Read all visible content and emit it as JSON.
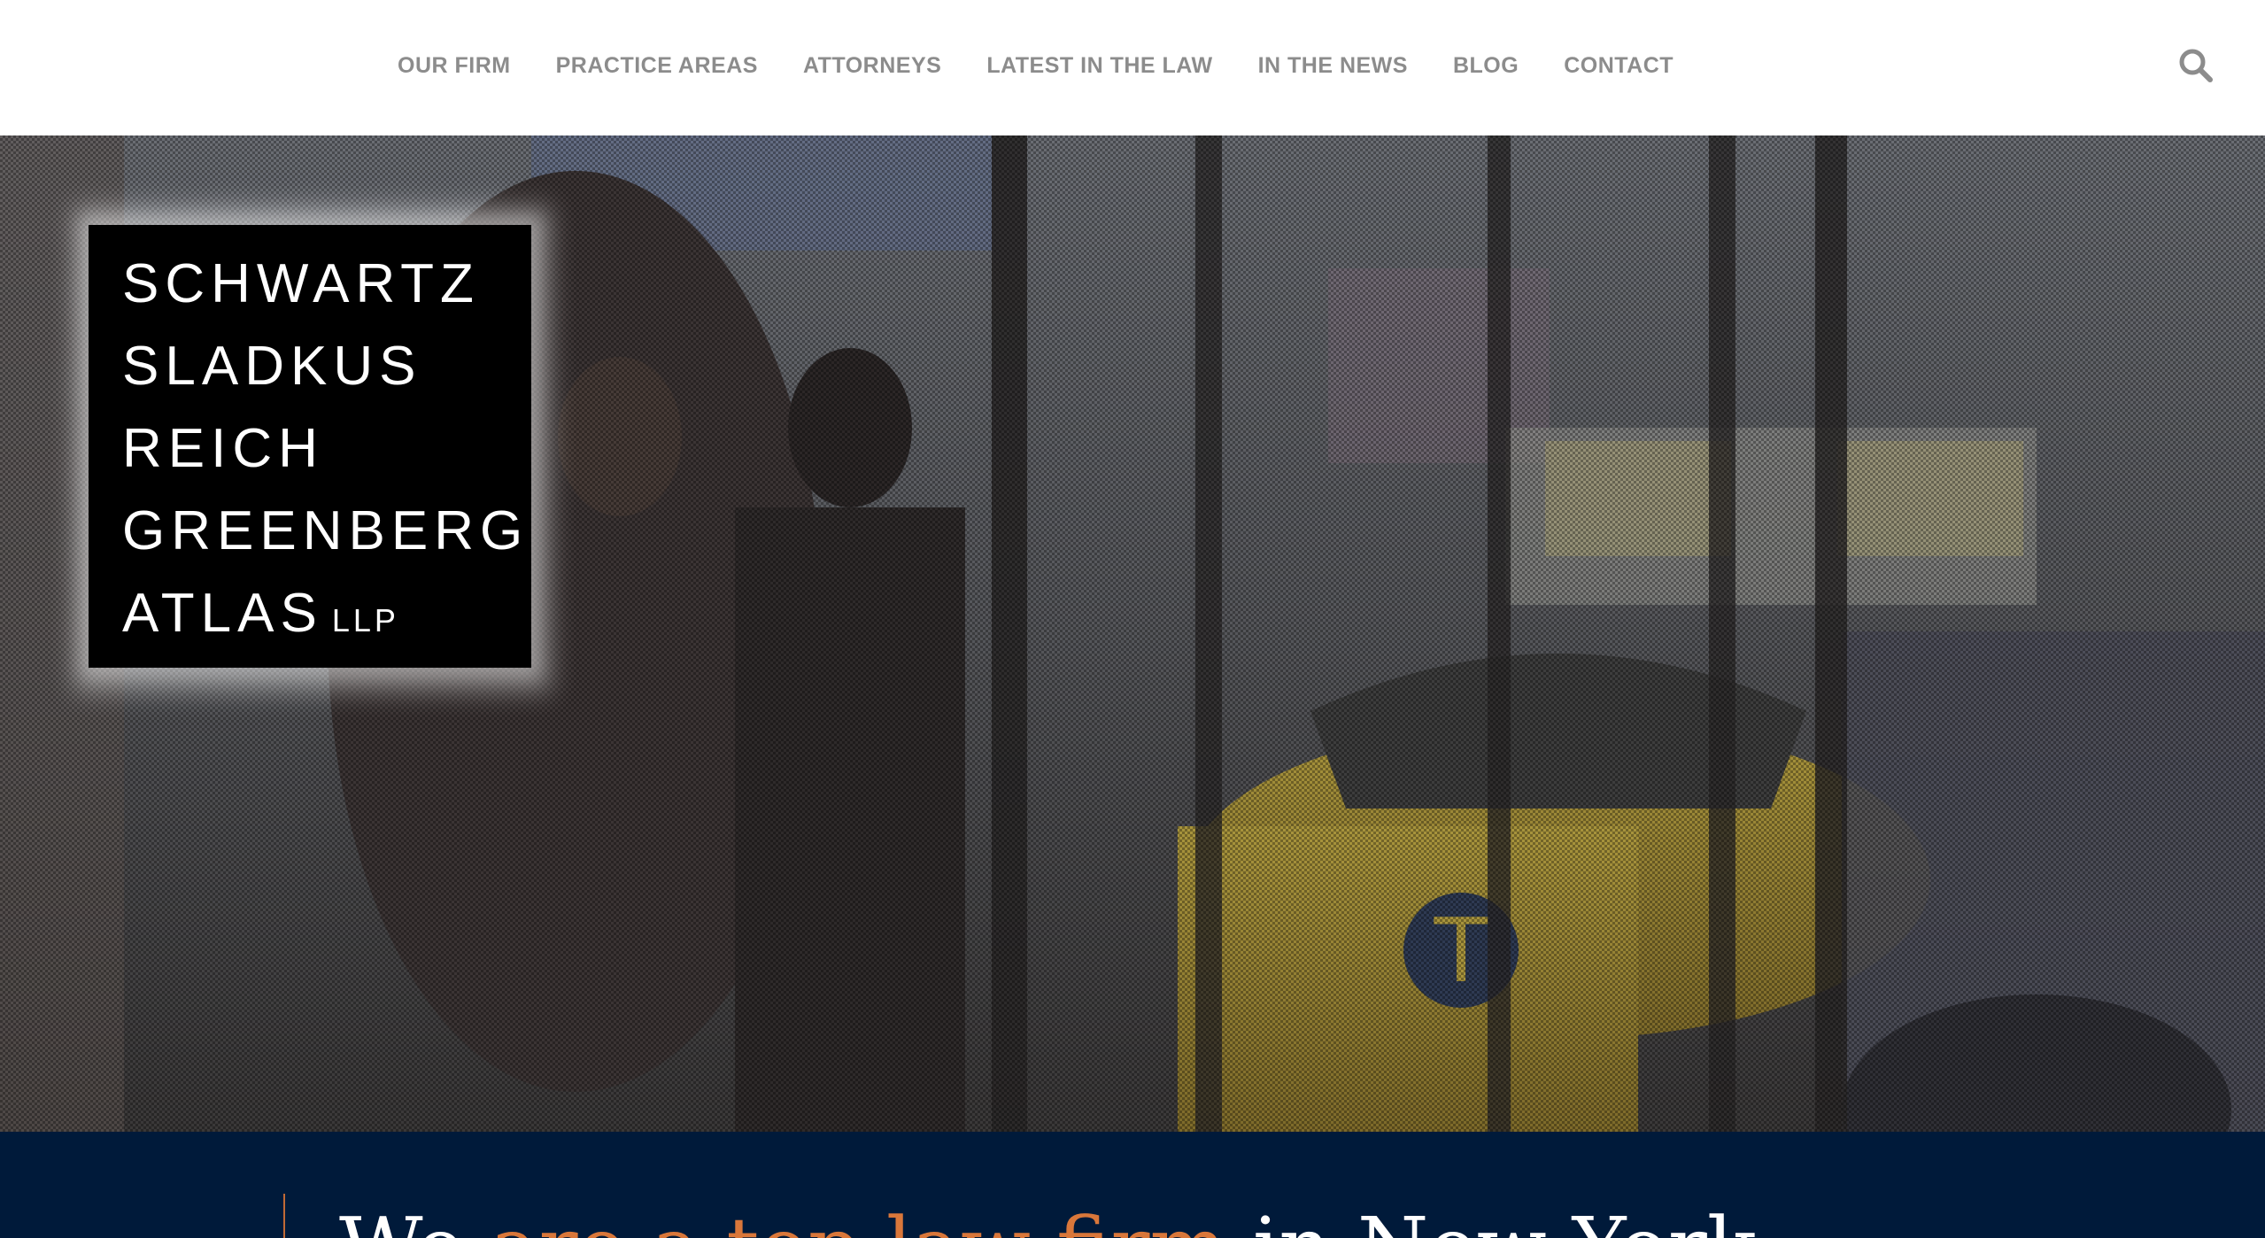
{
  "nav": {
    "items": [
      {
        "label": "OUR FIRM"
      },
      {
        "label": "PRACTICE AREAS"
      },
      {
        "label": "ATTORNEYS"
      },
      {
        "label": "LATEST IN THE LAW"
      },
      {
        "label": "IN THE NEWS"
      },
      {
        "label": "BLOG"
      },
      {
        "label": "CONTACT"
      }
    ],
    "search_icon": "search-icon"
  },
  "logo": {
    "lines": [
      "SCHWARTZ",
      "SLADKUS",
      "REICH",
      "GREENBERG",
      "ATLAS"
    ],
    "suffix": "LLP"
  },
  "tagline": {
    "lead": "We ",
    "accent": "are a top law firm",
    "tail": " in New York"
  },
  "colors": {
    "nav_text": "#8c8c8c",
    "logo_bg": "#000000",
    "band_bg": "#001a3a",
    "accent": "#d9773a"
  }
}
